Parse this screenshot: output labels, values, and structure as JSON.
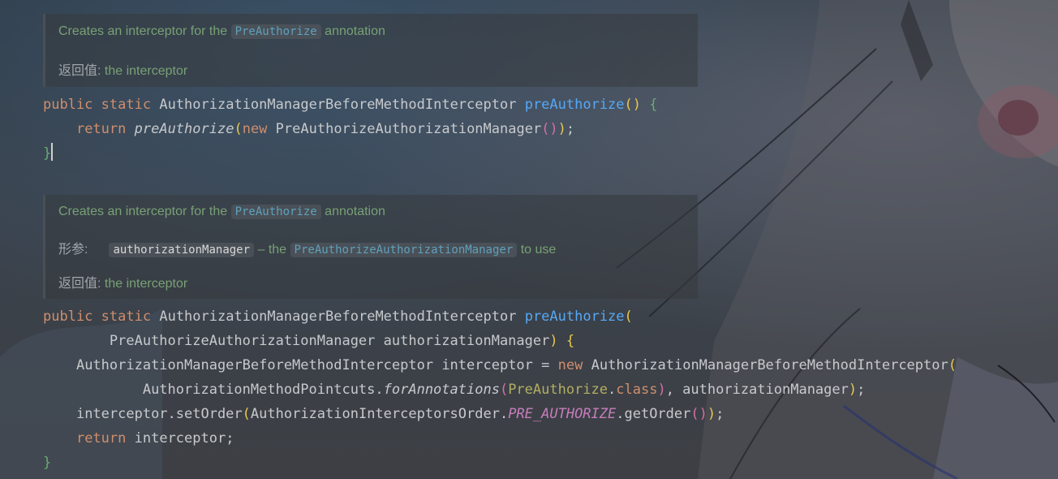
{
  "doc1": {
    "desc_before": "Creates an interceptor for the",
    "desc_tag": "PreAuthorize",
    "desc_after": "annotation",
    "returns_label": "返回值:",
    "returns_text": "the interceptor"
  },
  "code1": {
    "l1_kw1": "public",
    "l1_kw2": "static",
    "l1_type": "AuthorizationManagerBeforeMethodInterceptor",
    "l1_name": "preAuthorize",
    "l1_paren": "()",
    "l1_brace": "{",
    "l2_return": "return",
    "l2_call": "preAuthorize",
    "l2_open": "(",
    "l2_new": "new",
    "l2_class": "PreAuthorizeAuthorizationManager",
    "l2_inner": "()",
    "l2_close": ")",
    "l2_semi": ";",
    "l3_brace": "}"
  },
  "doc2": {
    "desc_before": "Creates an interceptor for the",
    "desc_tag": "PreAuthorize",
    "desc_after": "annotation",
    "params_label": "形参:",
    "param_name": "authorizationManager",
    "param_sep": "– the",
    "param_tag": "PreAuthorizeAuthorizationManager",
    "param_after": "to use",
    "returns_label": "返回值:",
    "returns_text": "the interceptor"
  },
  "code2": {
    "l1_kw1": "public",
    "l1_kw2": "static",
    "l1_type": "AuthorizationManagerBeforeMethodInterceptor",
    "l1_name": "preAuthorize",
    "l1_open": "(",
    "l2_type": "PreAuthorizeAuthorizationManager",
    "l2_param": "authorizationManager",
    "l2_close": ")",
    "l2_brace": "{",
    "l3_type": "AuthorizationManagerBeforeMethodInterceptor",
    "l3_var": "interceptor",
    "l3_eq": "=",
    "l3_new": "new",
    "l3_class": "AuthorizationManagerBeforeMethodInterceptor",
    "l3_open": "(",
    "l4_class": "AuthorizationMethodPointcuts.",
    "l4_method": "forAnnotations",
    "l4_open": "(",
    "l4_ann": "PreAuthorize",
    "l4_dot": ".",
    "l4_kwclass": "class",
    "l4_close": ")",
    "l4_rest": ", authorizationManager",
    "l4_end": ")",
    "l4_semi": ";",
    "l5_call": "interceptor.setOrder",
    "l5_open": "(",
    "l5_class": "AuthorizationInterceptorsOrder.",
    "l5_const": "PRE_AUTHORIZE",
    "l5_get": ".getOrder",
    "l5_inner": "()",
    "l5_close": ")",
    "l5_semi": ";",
    "l6_return": "return",
    "l6_var": "interceptor;",
    "l7_brace": "}"
  },
  "colors": {
    "keyword": "#cf8e6d",
    "function": "#56a8f5",
    "doc_text": "#78a175",
    "doc_tag": "#5ea1bd",
    "constant": "#c77dbb",
    "annotation": "#b3ae60"
  }
}
